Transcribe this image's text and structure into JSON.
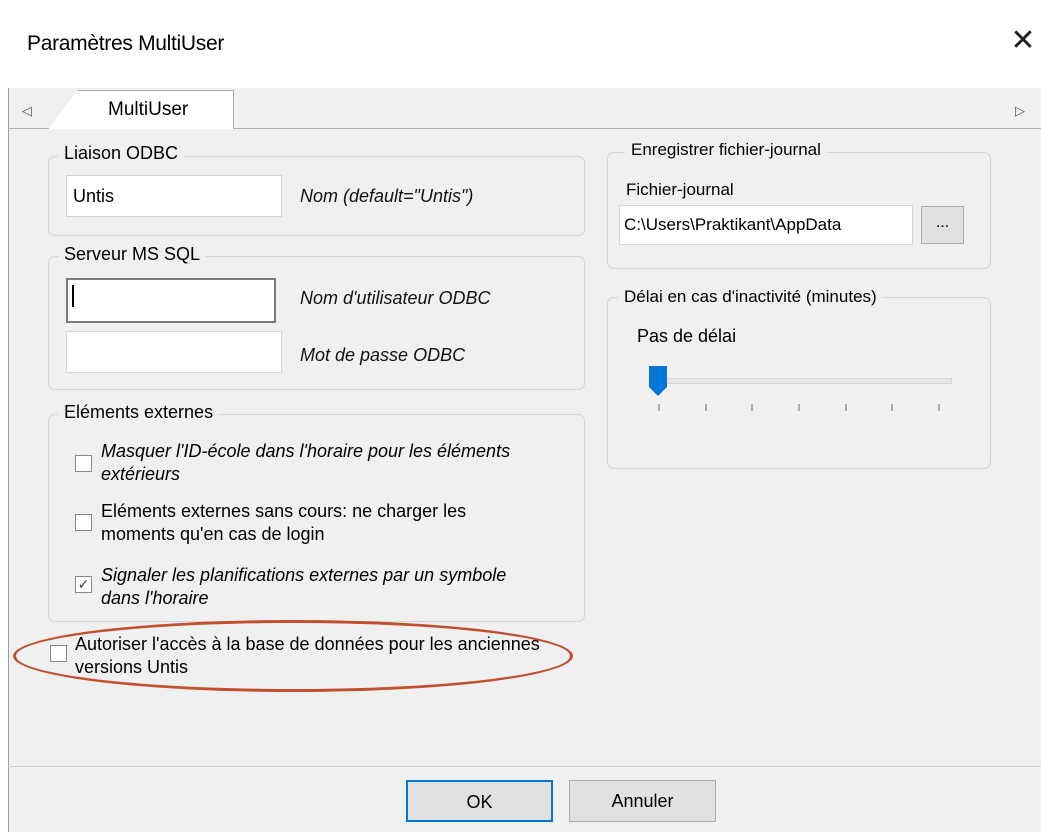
{
  "window": {
    "title": "Paramètres MultiUser"
  },
  "tabs": [
    {
      "label": "MultiUser"
    }
  ],
  "odbc": {
    "group_label": "Liaison ODBC",
    "name_value": "Untis",
    "name_hint": "Nom (default=\"Untis\")"
  },
  "mssql": {
    "group_label": "Serveur MS SQL",
    "user_value": "",
    "user_hint": "Nom d'utilisateur ODBC",
    "password_value": "",
    "password_hint": "Mot de passe ODBC"
  },
  "external": {
    "group_label": "Eléments externes",
    "options": [
      {
        "label": "Masquer l'ID-école dans l'horaire pour les éléments extérieurs",
        "checked": false
      },
      {
        "label": "Eléments externes sans cours: ne charger les moments qu'en cas de login",
        "checked": false
      },
      {
        "label": "Signaler les planifications externes par un symbole dans l'horaire",
        "checked": true
      }
    ]
  },
  "legacy": {
    "label": "Autoriser l'accès à la base de données pour les anciennes versions Untis",
    "checked": false
  },
  "log": {
    "group_label": "Enregistrer fichier-journal",
    "field_label": "Fichier-journal",
    "path_value": "C:\\Users\\Praktikant\\AppData",
    "browse_label": "..."
  },
  "inactivity": {
    "group_label": "Délai en cas d'inactivité (minutes)",
    "value_label": "Pas de délai",
    "slider_value": 0
  },
  "buttons": {
    "ok": "OK",
    "cancel": "Annuler"
  },
  "colors": {
    "highlight_oval": "#c0502e"
  }
}
